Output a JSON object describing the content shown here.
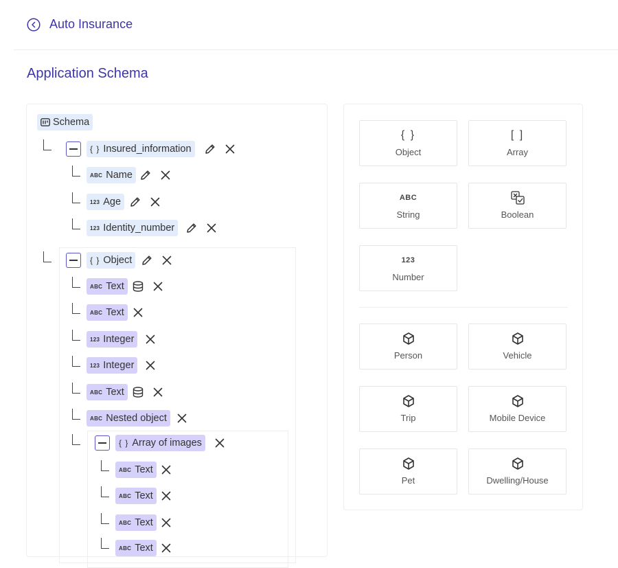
{
  "header": {
    "back_title": "Auto Insurance",
    "page_title": "Application Schema"
  },
  "tree": {
    "root": {
      "label": "Schema"
    },
    "insured": {
      "tag": "{ }",
      "label": "Insured_information"
    },
    "insured_children": [
      {
        "tag": "ABC",
        "label": "Name"
      },
      {
        "tag": "123",
        "label": "Age"
      },
      {
        "tag": "123",
        "label": "Identity_number"
      }
    ],
    "object": {
      "tag": "{ }",
      "label": "Object"
    },
    "object_children": [
      {
        "tag": "ABC",
        "label": "Text"
      },
      {
        "tag": "ABC",
        "label": "Text"
      },
      {
        "tag": "123",
        "label": "Integer"
      },
      {
        "tag": "123",
        "label": "Integer"
      },
      {
        "tag": "ABC",
        "label": "Text"
      },
      {
        "tag": "ABC",
        "label": "Nested object"
      }
    ],
    "array": {
      "tag": "{ }",
      "label": "Array of images"
    },
    "array_children": [
      {
        "tag": "ABC",
        "label": "Text"
      },
      {
        "tag": "ABC",
        "label": "Text"
      },
      {
        "tag": "ABC",
        "label": "Text"
      },
      {
        "tag": "ABC",
        "label": "Text"
      }
    ]
  },
  "types": {
    "primitives": [
      {
        "glyph": "{ }",
        "label": "Object",
        "icon": "braces-icon"
      },
      {
        "glyph": "[ ]",
        "label": "Array",
        "icon": "brackets-icon"
      },
      {
        "glyph": "ABC",
        "label": "String",
        "icon": "abc-icon"
      },
      {
        "glyph": "",
        "label": "Boolean",
        "icon": "boolean-icon"
      },
      {
        "glyph": "123",
        "label": "Number",
        "icon": "number-icon"
      }
    ],
    "entities": [
      {
        "label": "Person",
        "icon": "cube-icon"
      },
      {
        "label": "Vehicle",
        "icon": "cube-icon"
      },
      {
        "label": "Trip",
        "icon": "cube-icon"
      },
      {
        "label": "Mobile Device",
        "icon": "cube-icon"
      },
      {
        "label": "Pet",
        "icon": "cube-icon"
      },
      {
        "label": "Dwelling/House",
        "icon": "cube-icon"
      }
    ]
  },
  "colors": {
    "accent": "#3d35a8",
    "chip_light": "#e3ecfa",
    "chip_purple": "#d5d1fb"
  }
}
